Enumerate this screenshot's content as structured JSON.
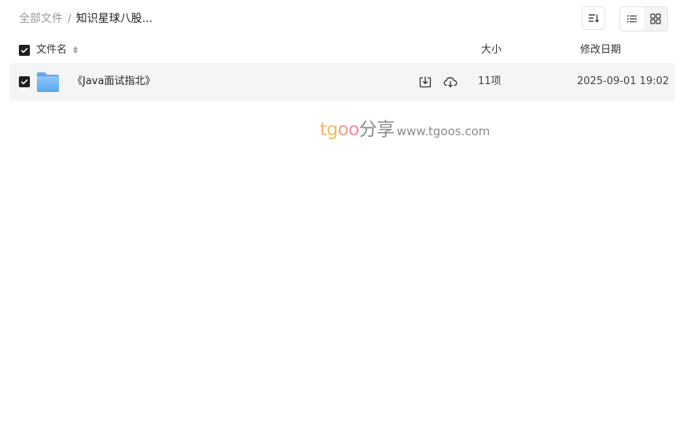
{
  "breadcrumb": {
    "root": "全部文件",
    "separator": "/",
    "current": "知识星球八股..."
  },
  "toolbar": {
    "sort_icon": "sort-lines-icon",
    "views": [
      {
        "icon": "list-view-icon",
        "active": true
      },
      {
        "icon": "grid-view-icon",
        "active": false
      }
    ]
  },
  "table": {
    "columns": {
      "name": "文件名",
      "size": "大小",
      "date": "修改日期"
    },
    "rows": [
      {
        "name": "《Java面试指北》",
        "size": "11项",
        "date": "2025-09-01 19:02",
        "icon": "folder-icon",
        "actions": [
          "download-icon",
          "cloud-save-icon"
        ],
        "checked": true
      }
    ]
  },
  "watermark": {
    "brand_t": "t",
    "brand_g": "g",
    "brand_o1": "o",
    "brand_o2": "o",
    "brand_cn": "分享",
    "url": "www.tgoos.com",
    "colors": {
      "t": "#f5b46a",
      "g": "#f0c060",
      "o1": "#f39a8c",
      "o2": "#f08aa8",
      "cn": "#8a8a8a"
    }
  },
  "colors": {
    "checkbox": "#1f1f1f",
    "row_bg": "#f5f5f5",
    "folder": "#6fb2f2"
  }
}
